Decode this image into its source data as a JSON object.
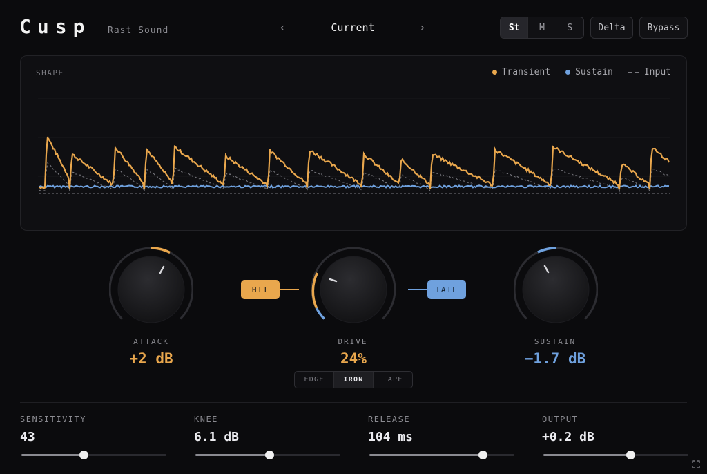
{
  "header": {
    "title": "Cusp",
    "vendor": "Rast Sound",
    "preset": "Current",
    "prev_icon": "chevron-left-icon",
    "next_icon": "chevron-right-icon",
    "modes": [
      "St",
      "M",
      "S"
    ],
    "active_mode": "St",
    "delta_label": "Delta",
    "bypass_label": "Bypass"
  },
  "shape": {
    "label": "SHAPE",
    "legend": [
      {
        "name": "Transient",
        "color": "#e9a74d",
        "style": "dot"
      },
      {
        "name": "Sustain",
        "color": "#6fa1de",
        "style": "dot"
      },
      {
        "name": "Input",
        "color": "#7a7a80",
        "style": "dashed"
      }
    ]
  },
  "knobs": {
    "attack": {
      "label": "ATTACK",
      "value": "+2 dB",
      "color": "#e9a74d"
    },
    "drive": {
      "label": "DRIVE",
      "value": "24%",
      "color": "#e9a74d"
    },
    "sustain": {
      "label": "SUSTAIN",
      "value": "−1.7 dB",
      "color": "#6fa1de"
    }
  },
  "badges": {
    "hit": "HIT",
    "tail": "TAIL"
  },
  "saturation_modes": [
    "EDGE",
    "IRON",
    "TAPE"
  ],
  "active_saturation": "IRON",
  "sliders": [
    {
      "label": "SENSITIVITY",
      "value": "43",
      "position": 0.43
    },
    {
      "label": "KNEE",
      "value": "6.1 dB",
      "position": 0.51
    },
    {
      "label": "RELEASE",
      "value": "104 ms",
      "position": 0.78
    },
    {
      "label": "OUTPUT",
      "value": "+0.2 dB",
      "position": 0.6
    }
  ],
  "colors": {
    "transient": "#e9a74d",
    "sustain": "#6fa1de",
    "input": "#7a7a80"
  },
  "expand_icon": "expand-icon"
}
